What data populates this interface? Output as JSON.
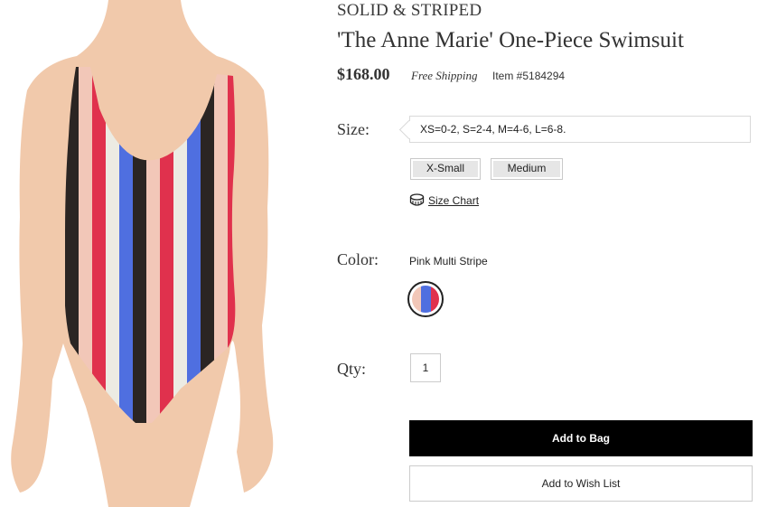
{
  "product": {
    "brand": "SOLID & STRIPED",
    "title": "'The Anne Marie' One-Piece Swimsuit",
    "price": "$168.00",
    "shipping": "Free Shipping",
    "item_number": "Item #5184294",
    "image_stripe_colors": [
      "#2b2523",
      "#f2c7b8",
      "#e0314d",
      "#ecebe3",
      "#4f6fe0"
    ]
  },
  "size": {
    "label": "Size:",
    "hint": "XS=0-2, S=2-4, M=4-6, L=6-8.",
    "options": [
      "X-Small",
      "Medium"
    ],
    "chart_link": "Size Chart"
  },
  "color": {
    "label": "Color:",
    "selected_name": "Pink Multi Stripe",
    "swatch_colors": [
      "#f2c7b8",
      "#4f6fe0",
      "#e0314d"
    ]
  },
  "quantity": {
    "label": "Qty:",
    "value": "1"
  },
  "actions": {
    "add_to_bag": "Add to Bag",
    "add_to_wish_list": "Add to Wish List"
  }
}
